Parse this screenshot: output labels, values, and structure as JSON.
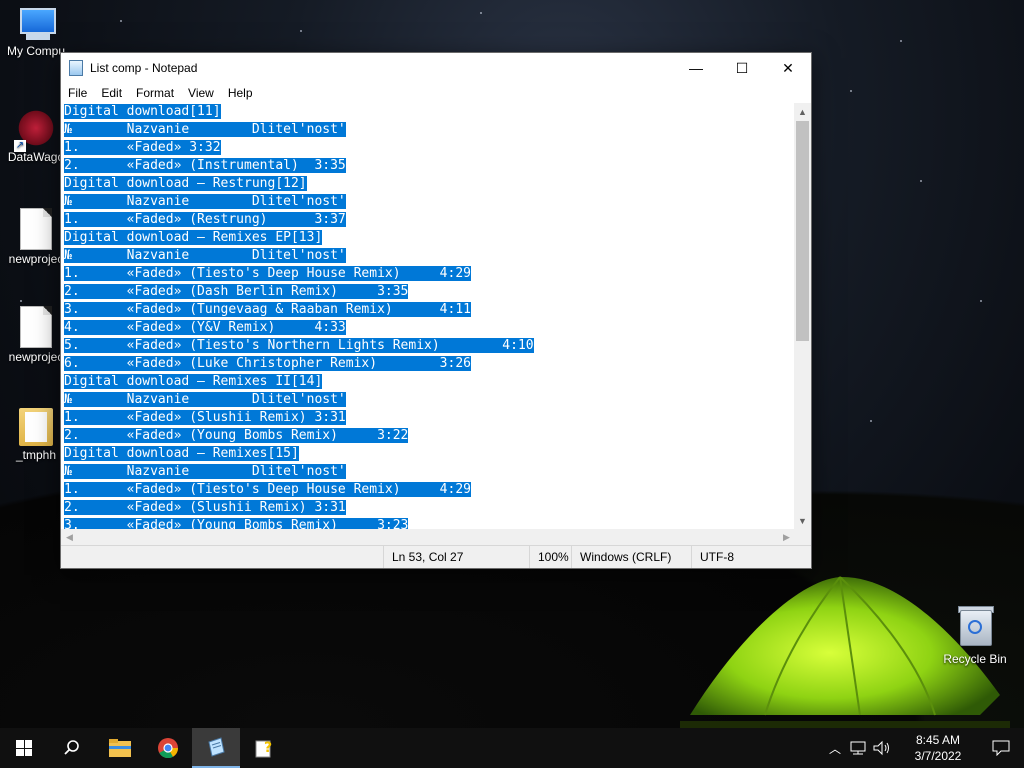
{
  "desktop": {
    "icons": [
      {
        "label": "My Compu"
      },
      {
        "label": "DataWago"
      },
      {
        "label": "newprojec"
      },
      {
        "label": "newprojec"
      },
      {
        "label": "_tmphh"
      },
      {
        "label": "Recycle Bin"
      }
    ]
  },
  "window": {
    "title": "List comp - Notepad",
    "controls": {
      "minimize": "—",
      "maximize": "☐",
      "close": "✕"
    },
    "menu": [
      "File",
      "Edit",
      "Format",
      "View",
      "Help"
    ],
    "lines": [
      "Digital download[11]",
      "№       Nazvanie        Dlitel'nost'",
      "1.      «Faded» 3:32",
      "2.      «Faded» (Instrumental)  3:35",
      "Digital download – Restrung[12]",
      "№       Nazvanie        Dlitel'nost'",
      "1.      «Faded» (Restrung)      3:37",
      "Digital download – Remixes EP[13]",
      "№       Nazvanie        Dlitel'nost'",
      "1.      «Faded» (Tiesto's Deep House Remix)     4:29",
      "2.      «Faded» (Dash Berlin Remix)     3:35",
      "3.      «Faded» (Tungevaag & Raaban Remix)      4:11",
      "4.      «Faded» (Y&V Remix)     4:33",
      "5.      «Faded» (Tiesto's Northern Lights Remix)        4:10",
      "6.      «Faded» (Luke Christopher Remix)        3:26",
      "Digital download – Remixes II[14]",
      "№       Nazvanie        Dlitel'nost'",
      "1.      «Faded» (Slushii Remix) 3:31",
      "2.      «Faded» (Young Bombs Remix)     3:22",
      "Digital download – Remixes[15]",
      "№       Nazvanie        Dlitel'nost'",
      "1.      «Faded» (Tiesto's Deep House Remix)     4:29",
      "2.      «Faded» (Slushii Remix) 3:31",
      "3.      «Faded» (Young Bombs Remix)     3:23"
    ],
    "status": {
      "position": "Ln 53, Col 27",
      "zoom": "100%",
      "line_endings": "Windows (CRLF)",
      "encoding": "UTF-8"
    },
    "selection_color": "#0078d7"
  },
  "taskbar": {
    "clock_time": "8:45 AM",
    "clock_date": "3/7/2022",
    "items": [
      "start",
      "search",
      "file-explorer",
      "chrome",
      "notepad",
      "help-app"
    ]
  }
}
